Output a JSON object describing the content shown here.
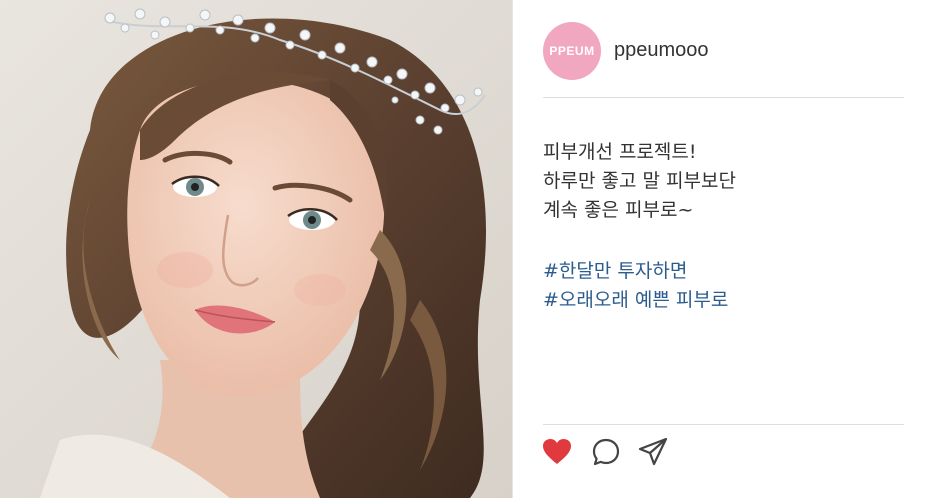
{
  "post": {
    "avatar_text": "PPEUM",
    "username": "ppeumooo",
    "caption_lines": [
      "피부개선 프로젝트!",
      "하루만 좋고 말 피부보단",
      "계속 좋은 피부로~"
    ],
    "hashtags": [
      "#한달만 투자하면",
      "#오래오래 예쁜 피부로"
    ],
    "liked": true
  },
  "icons": {
    "like": "heart-icon",
    "comment": "comment-bubble-icon",
    "share": "paper-plane-icon"
  },
  "colors": {
    "avatar_bg": "#f2a7c0",
    "hashtag": "#2c5c8f",
    "heart": "#e0393e"
  }
}
